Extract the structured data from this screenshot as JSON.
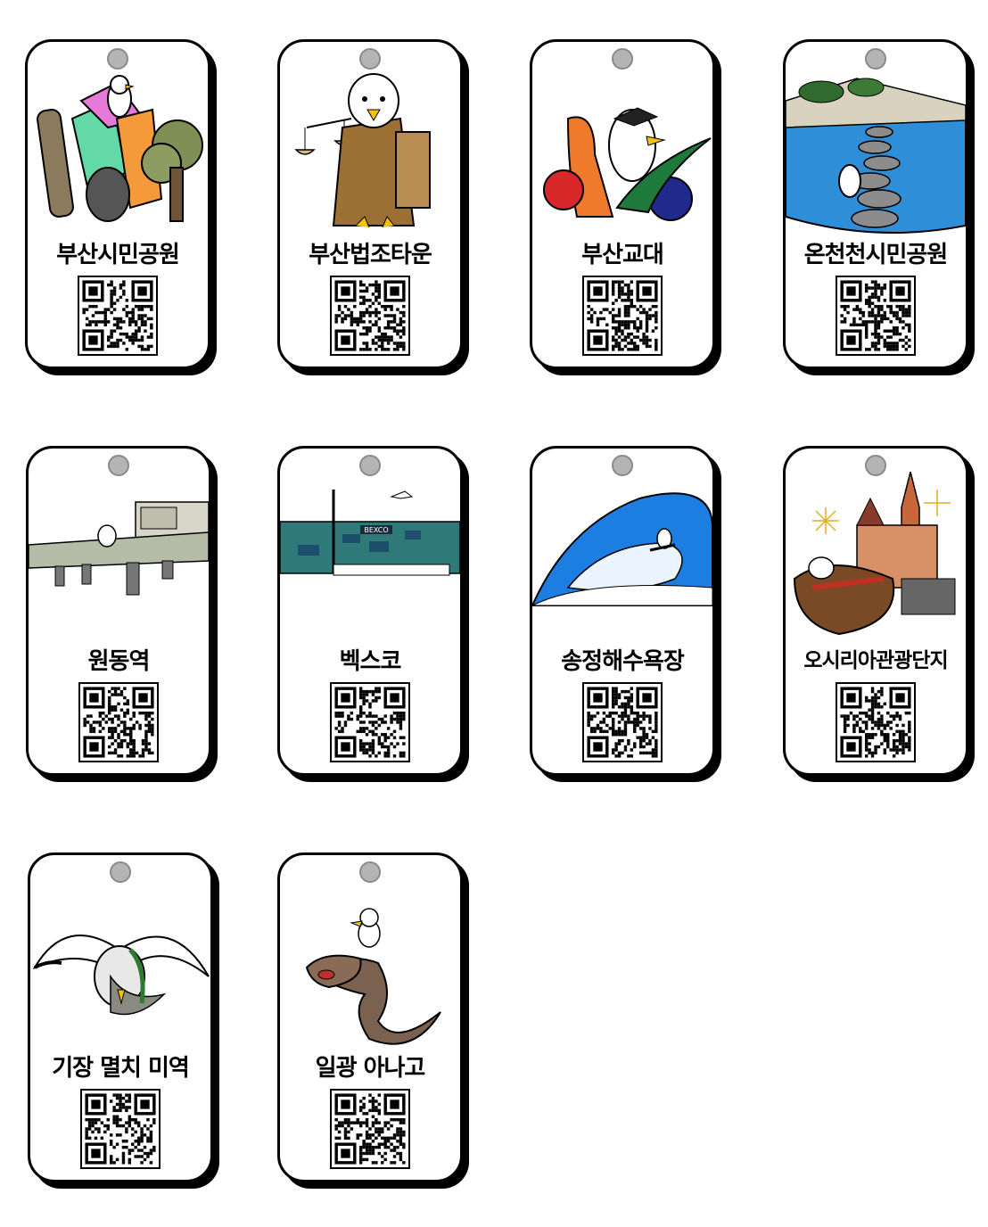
{
  "cards": [
    {
      "title": "부산시민공원",
      "art": "citizens-park-art",
      "qr": "qr-code-icon"
    },
    {
      "title": "부산법조타운",
      "art": "law-town-art",
      "qr": "qr-code-icon"
    },
    {
      "title": "부산교대",
      "art": "education-university-art",
      "qr": "qr-code-icon"
    },
    {
      "title": "온천천시민공원",
      "art": "oncheoncheon-park-art",
      "qr": "qr-code-icon"
    },
    {
      "title": "원동역",
      "art": "wondong-station-art",
      "qr": "qr-code-icon"
    },
    {
      "title": "벡스코",
      "art": "bexco-art",
      "qr": "qr-code-icon",
      "sign": "BEXCO"
    },
    {
      "title": "송정해수욕장",
      "art": "songjeong-beach-art",
      "qr": "qr-code-icon"
    },
    {
      "title": "오시리아관광단지",
      "art": "osiria-tourism-art",
      "qr": "qr-code-icon"
    },
    {
      "title": "기장 멸치 미역",
      "art": "gijang-anchovy-seaweed-art",
      "qr": "qr-code-icon"
    },
    {
      "title": "일광 아나고",
      "art": "ilgwang-anago-art",
      "qr": "qr-code-icon"
    }
  ],
  "colors": {
    "hole": "#b4b4b4",
    "shadow": "#000000",
    "card": "#ffffff"
  }
}
